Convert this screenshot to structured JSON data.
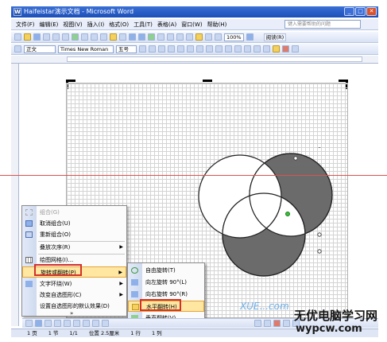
{
  "window": {
    "title": "Haifeistar演示文档 - Microsoft Word",
    "app_icon": "W"
  },
  "menubar": {
    "items": [
      "文件(F)",
      "编辑(E)",
      "视图(V)",
      "插入(I)",
      "格式(O)",
      "工具(T)",
      "表格(A)",
      "窗口(W)",
      "帮助(H)"
    ],
    "help_placeholder": "键入需要帮助的问题"
  },
  "toolbar": {
    "zoom": "100%",
    "read_label": "阅读(R)"
  },
  "format_toolbar": {
    "style": "正文",
    "font": "Times New Roman",
    "size": "五号"
  },
  "context_menu": {
    "items": [
      {
        "label": "组合(G)",
        "disabled": true
      },
      {
        "label": "取消组合(U)"
      },
      {
        "label": "重新组合(O)"
      },
      {
        "label": "叠放次序(R)",
        "submenu": true
      },
      {
        "label": "绘图网格(I)..."
      },
      {
        "label": "旋转或翻转(P)",
        "submenu": true,
        "highlighted": true
      },
      {
        "label": "文字环绕(W)",
        "submenu": true
      },
      {
        "label": "改变自选图形(C)",
        "submenu": true
      },
      {
        "label": "设置自选图形的默认效果(D)"
      }
    ],
    "more": "»"
  },
  "submenu": {
    "items": [
      {
        "label": "自由旋转(T)"
      },
      {
        "label": "向左旋转 90°(L)"
      },
      {
        "label": "向右旋转 90°(R)"
      },
      {
        "label": "水平翻转(H)",
        "highlighted": true
      },
      {
        "label": "垂直翻转(V)"
      }
    ]
  },
  "statusbar": {
    "page": "1 页",
    "section": "1 节",
    "pages": "1/1",
    "position": "位置 2.5厘米",
    "line": "1 行",
    "column": "1 列"
  },
  "watermark": {
    "line1": "无优电脑学习网",
    "line2": "wypcw.com",
    "overlay": "XUE...com"
  },
  "colors": {
    "title_bar": "#1c4fb8",
    "highlight": "#ffe7a2",
    "callout_red": "#d3302a",
    "guide_line": "#d9534f",
    "shape_fill_dark": "#6b6b6b"
  }
}
